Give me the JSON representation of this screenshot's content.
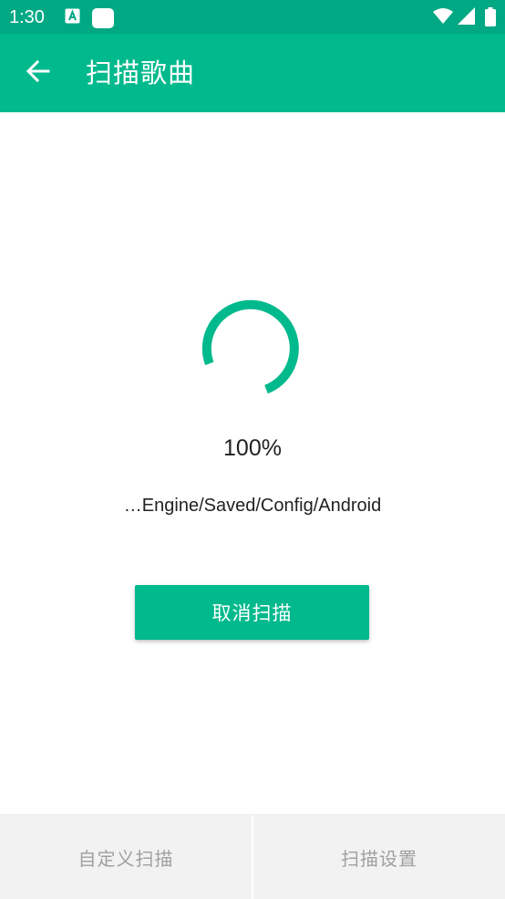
{
  "status_bar": {
    "time": "1:30",
    "left_icons": [
      "accessibility-icon",
      "notification-square-icon"
    ],
    "right_icons": [
      "wifi-icon",
      "signal-icon",
      "battery-icon"
    ]
  },
  "app_bar": {
    "title": "扫描歌曲",
    "back_icon": "arrow-left-icon"
  },
  "scan": {
    "progress_percent": 100,
    "progress_text": "100%",
    "current_path": "…Engine/Saved/Config/Android",
    "cancel_label": "取消扫描"
  },
  "bottom_bar": {
    "custom_scan_label": "自定义扫描",
    "scan_settings_label": "扫描设置"
  },
  "colors": {
    "status_bar": "#00a884",
    "primary": "#00b98c",
    "bottom_bar": "#f2f2f2",
    "bottom_text": "#a0a0a0"
  }
}
